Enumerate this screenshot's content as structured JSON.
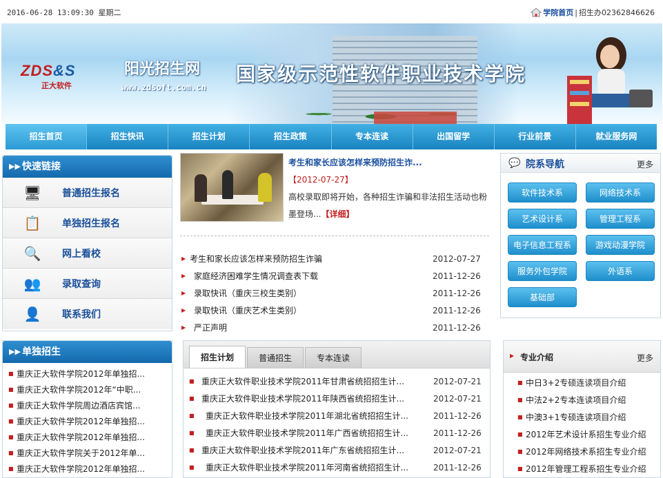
{
  "topbar": {
    "datetime": "2016-06-28 13:09:30 星期二",
    "home_link": "学院首页",
    "separator": "|",
    "contact": "招生办02362846626"
  },
  "banner": {
    "logo_text": "ZDS",
    "logo_amp": "&S",
    "logo_cn": "正大软件",
    "site_title": "阳光招生网",
    "site_url": "www.zdsoft.com.cn",
    "slogan": "国家级示范性软件职业技术学院"
  },
  "nav": {
    "items": [
      "招生首页",
      "招生快讯",
      "招生计划",
      "招生政策",
      "专本连读",
      "出国留学",
      "行业前景",
      "就业服务网"
    ]
  },
  "quick_links": {
    "title": "快速链接",
    "items": [
      {
        "label": "普通招生报名",
        "icon": "computer-icon"
      },
      {
        "label": "单独招生报名",
        "icon": "form-icon"
      },
      {
        "label": "网上看校",
        "icon": "magnifier-icon"
      },
      {
        "label": "录取查询",
        "icon": "users-icon"
      },
      {
        "label": "联系我们",
        "icon": "contact-icon"
      }
    ]
  },
  "featured": {
    "title": "考生和家长应该怎样来预防招生诈...",
    "date": "【2012-07-27】",
    "body": "高校录取即将开始，各种招生诈骗和非法招生活动也粉墨登场...",
    "more": "【详细】"
  },
  "news": [
    {
      "title": "考生和家长应该怎样来预防招生诈骗",
      "date": "2012-07-27"
    },
    {
      "title": "家庭经济困难学生情况调查表下载",
      "date": "2011-12-26"
    },
    {
      "title": "录取快讯（重庆三校生类别）",
      "date": "2011-12-26"
    },
    {
      "title": "录取快讯（重庆艺术生类别）",
      "date": "2011-12-26"
    },
    {
      "title": "严正声明",
      "date": "2011-12-26"
    }
  ],
  "departments": {
    "title": "院系导航",
    "more": "更多",
    "items": [
      "软件技术系",
      "网络技术系",
      "艺术设计系",
      "管理工程系",
      "电子信息工程系",
      "游戏动漫学院",
      "服务外包学院",
      "外语系",
      "基础部"
    ]
  },
  "independent": {
    "title": "单独招生",
    "items": [
      "重庆正大软件学院2012年单独招...",
      "重庆正大软件学院2012年“中职...",
      "重庆正大软件学院周边酒店宾馆...",
      "重庆正大软件学院2012年单独招...",
      "重庆正大软件学院2012年单独招...",
      "重庆正大软件学院关于2012年单...",
      "重庆正大软件学院2012年单独招..."
    ]
  },
  "plan": {
    "tabs": [
      "招生计划",
      "普通招生",
      "专本连读"
    ],
    "items": [
      {
        "title": "重庆正大软件职业技术学院2011年甘肃省统招招生计...",
        "date": "2012-07-21"
      },
      {
        "title": "重庆正大软件职业技术学院2011年陕西省统招招生计...",
        "date": "2012-07-21"
      },
      {
        "title": "重庆正大软件职业技术学院2011年湖北省统招招生计...",
        "date": "2011-12-26"
      },
      {
        "title": "重庆正大软件职业技术学院2011年广西省统招招生计...",
        "date": "2011-12-26"
      },
      {
        "title": "重庆正大软件职业技术学院2011年广东省统招招生计...",
        "date": "2012-07-21"
      },
      {
        "title": "重庆正大软件职业技术学院2011年河南省统招招生计...",
        "date": "2011-12-26"
      }
    ]
  },
  "majors": {
    "title": "专业介绍",
    "more": "更多",
    "items": [
      "中日3+2专硕连读项目介绍",
      "中法2+2专本连读项目介绍",
      "中澳3+1专硕连读项目介绍",
      "2012年艺术设计系招生专业介绍",
      "2012年网络技术系招生专业介绍",
      "2012年管理工程系招生专业介绍"
    ]
  }
}
